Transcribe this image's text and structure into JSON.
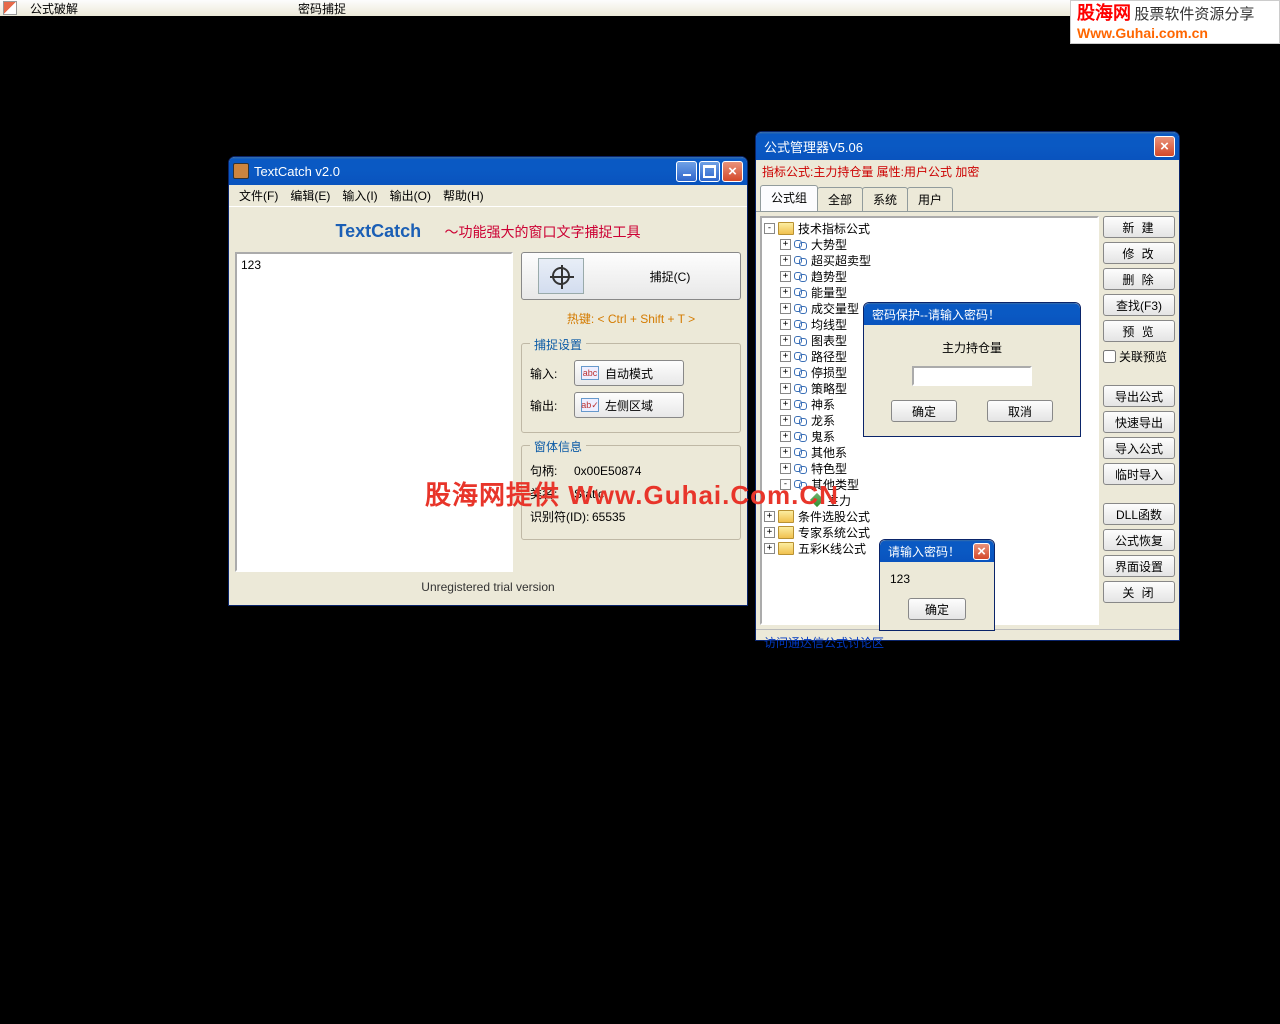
{
  "topbar": {
    "menu1": "公式破解",
    "menu2": "密码捕捉"
  },
  "brand": {
    "name": "股海网",
    "slogan": "股票软件资源分享",
    "url": "Www.Guhai.com.cn"
  },
  "watermark": "股海网提供  Www.Guhai.Com.CN",
  "textcatch": {
    "title": "TextCatch v2.0",
    "menus": [
      "文件(F)",
      "编辑(E)",
      "输入(I)",
      "输出(O)",
      "帮助(H)"
    ],
    "logo": "TextCatch",
    "subtitle": "～功能强大的窗口文字捕捉工具",
    "textarea": "123",
    "capture_btn": "捕捉(C)",
    "hotkey": "热键:  < Ctrl + Shift + T >",
    "grp_capture": "捕捉设置",
    "input_lbl": "输入:",
    "input_btn": "自动模式",
    "output_lbl": "输出:",
    "output_btn": "左侧区域",
    "grp_win": "窗体信息",
    "handle_lbl": "句柄:",
    "handle_val": "0x00E50874",
    "class_lbl": "类名:",
    "class_val": "Static",
    "id_lbl": "识别符(ID):",
    "id_val": "65535",
    "footer": "Unregistered trial version"
  },
  "fm": {
    "title": "公式管理器V5.06",
    "info": "指标公式:主力持仓量 属性:用户公式 加密",
    "tabs": [
      "公式组",
      "全部",
      "系统",
      "用户"
    ],
    "tree_root": "技术指标公式",
    "tree_items": [
      "大势型",
      "超买超卖型",
      "趋势型",
      "能量型",
      "成交量型",
      "均线型",
      "图表型",
      "路径型",
      "停损型",
      "策略型",
      "神系",
      "龙系",
      "鬼系",
      "其他系",
      "特色型"
    ],
    "tree_other": "其他类型",
    "tree_leaf": "主力",
    "tree_tail": [
      "条件选股公式",
      "专家系统公式",
      "五彩K线公式"
    ],
    "btns1": [
      "新  建",
      "修  改",
      "删  除",
      "查找(F3)",
      "预  览"
    ],
    "chk": "关联预览",
    "btns2": [
      "导出公式",
      "快速导出",
      "导入公式",
      "临时导入"
    ],
    "btns3": [
      "DLL函数",
      "公式恢复",
      "界面设置",
      "关  闭"
    ],
    "footer": "访问通达信公式讨论区"
  },
  "pwd1": {
    "title": "密码保护--请输入密码！",
    "label": "主力持仓量",
    "ok": "确定",
    "cancel": "取消"
  },
  "pwd2": {
    "title": "请输入密码！",
    "value": "123",
    "ok": "确定"
  }
}
